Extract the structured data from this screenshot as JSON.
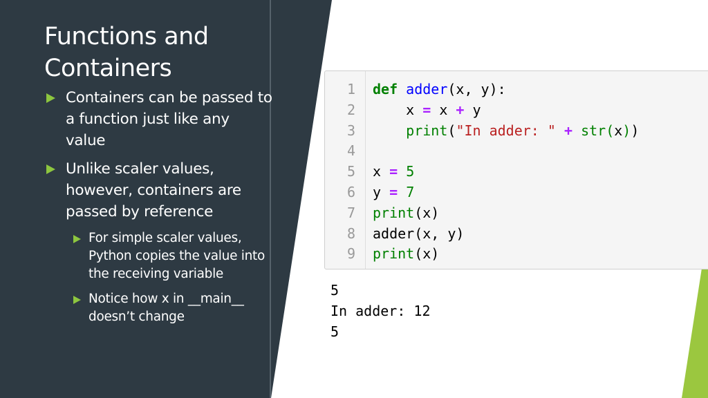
{
  "slide": {
    "title_line1": "Functions and",
    "title_line2": "Containers",
    "bullets": [
      {
        "text": "Containers can be passed to a function just like any value"
      },
      {
        "text": "Unlike scaler values, however, containers are passed by reference"
      }
    ],
    "sub_bullets": [
      {
        "text": "For simple scaler values, Python copies the value into the receiving variable"
      },
      {
        "text": "Notice how x in __main__ doesn’t change"
      }
    ],
    "colors": {
      "dark_panel": "#2e3a43",
      "accent_green": "#8dc63f",
      "code_bg": "#f5f5f5"
    }
  },
  "code": {
    "line_numbers": [
      "1",
      "2",
      "3",
      "4",
      "5",
      "6",
      "7",
      "8",
      "9"
    ],
    "lines": [
      [
        {
          "t": "def",
          "c": "kw"
        },
        {
          "t": " ",
          "c": "txt"
        },
        {
          "t": "adder",
          "c": "fn"
        },
        {
          "t": "(x, y):",
          "c": "txt"
        }
      ],
      [
        {
          "t": "    x ",
          "c": "txt"
        },
        {
          "t": "=",
          "c": "op"
        },
        {
          "t": " x ",
          "c": "txt"
        },
        {
          "t": "+",
          "c": "op"
        },
        {
          "t": " y",
          "c": "txt"
        }
      ],
      [
        {
          "t": "    ",
          "c": "txt"
        },
        {
          "t": "print",
          "c": "bi"
        },
        {
          "t": "(",
          "c": "txt"
        },
        {
          "t": "\"In adder: \"",
          "c": "str"
        },
        {
          "t": " ",
          "c": "txt"
        },
        {
          "t": "+",
          "c": "op"
        },
        {
          "t": " ",
          "c": "txt"
        },
        {
          "t": "str",
          "c": "bi"
        },
        {
          "t": "(",
          "c": "bi"
        },
        {
          "t": "x",
          "c": "txt"
        },
        {
          "t": ")",
          "c": "bi"
        },
        {
          "t": ")",
          "c": "txt"
        }
      ],
      [
        {
          "t": "",
          "c": "txt"
        }
      ],
      [
        {
          "t": "x ",
          "c": "txt"
        },
        {
          "t": "=",
          "c": "op"
        },
        {
          "t": " ",
          "c": "txt"
        },
        {
          "t": "5",
          "c": "num"
        }
      ],
      [
        {
          "t": "y ",
          "c": "txt"
        },
        {
          "t": "=",
          "c": "op"
        },
        {
          "t": " ",
          "c": "txt"
        },
        {
          "t": "7",
          "c": "num"
        }
      ],
      [
        {
          "t": "print",
          "c": "bi"
        },
        {
          "t": "(x)",
          "c": "txt"
        }
      ],
      [
        {
          "t": "adder(x, y)",
          "c": "txt"
        }
      ],
      [
        {
          "t": "print",
          "c": "bi"
        },
        {
          "t": "(x)",
          "c": "txt"
        }
      ]
    ]
  },
  "output": {
    "lines": [
      "5",
      "In adder: 12",
      "5"
    ]
  }
}
